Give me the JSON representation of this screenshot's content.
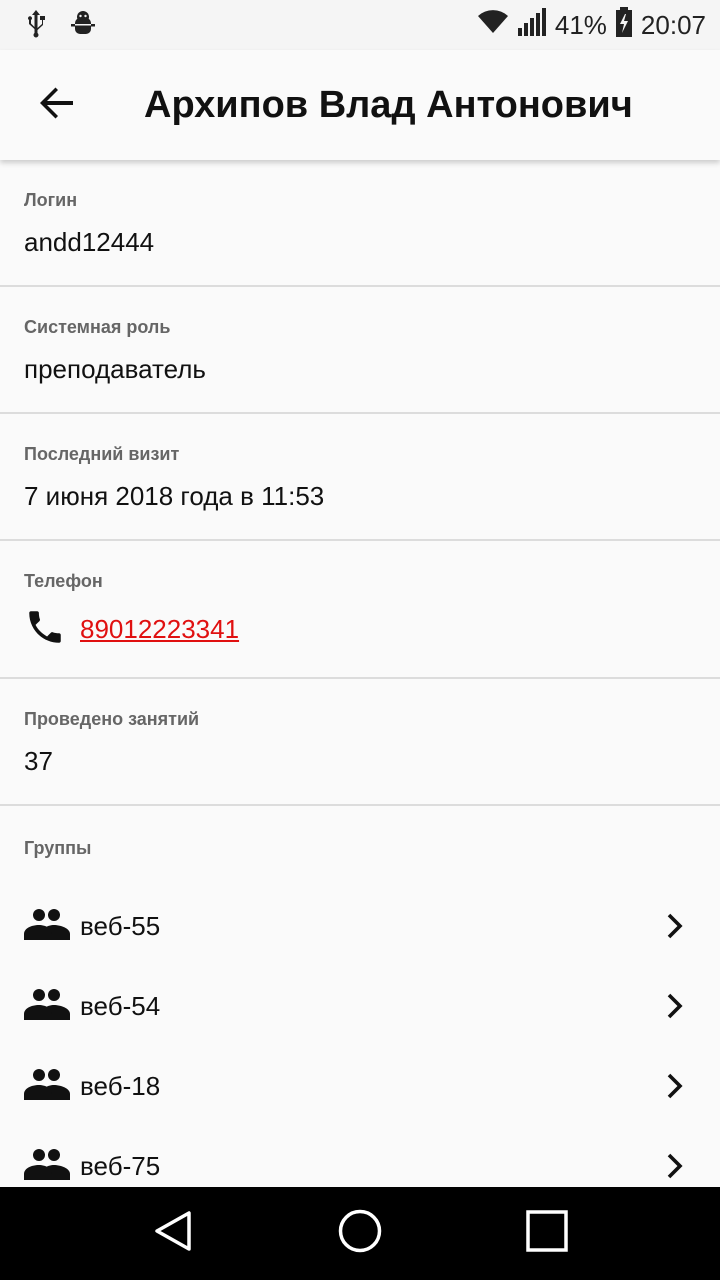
{
  "status_bar": {
    "battery": "41%",
    "time": "20:07",
    "icons": [
      "usb-icon",
      "debug-icon",
      "wifi-icon",
      "signal-icon",
      "battery-icon"
    ]
  },
  "app_bar": {
    "title": "Архипов Влад Антонович",
    "back_icon": "arrow-back-icon"
  },
  "fields": {
    "login": {
      "label": "Логин",
      "value": "andd12444"
    },
    "role": {
      "label": "Системная роль",
      "value": "преподаватель"
    },
    "last_visit": {
      "label": "Последний визит",
      "value": "7 июня 2018 года в 11:53"
    },
    "phone": {
      "label": "Телефон",
      "value": "89012223341",
      "icon": "phone-icon",
      "link_color": "#e01010"
    },
    "lessons": {
      "label": "Проведено занятий",
      "value": "37"
    }
  },
  "groups": {
    "label": "Группы",
    "items": [
      {
        "name": "веб-55"
      },
      {
        "name": "веб-54"
      },
      {
        "name": "веб-18"
      },
      {
        "name": "веб-75"
      }
    ]
  },
  "nav_bar": {
    "icons": [
      "back-triangle-icon",
      "home-circle-icon",
      "recents-square-icon"
    ]
  }
}
